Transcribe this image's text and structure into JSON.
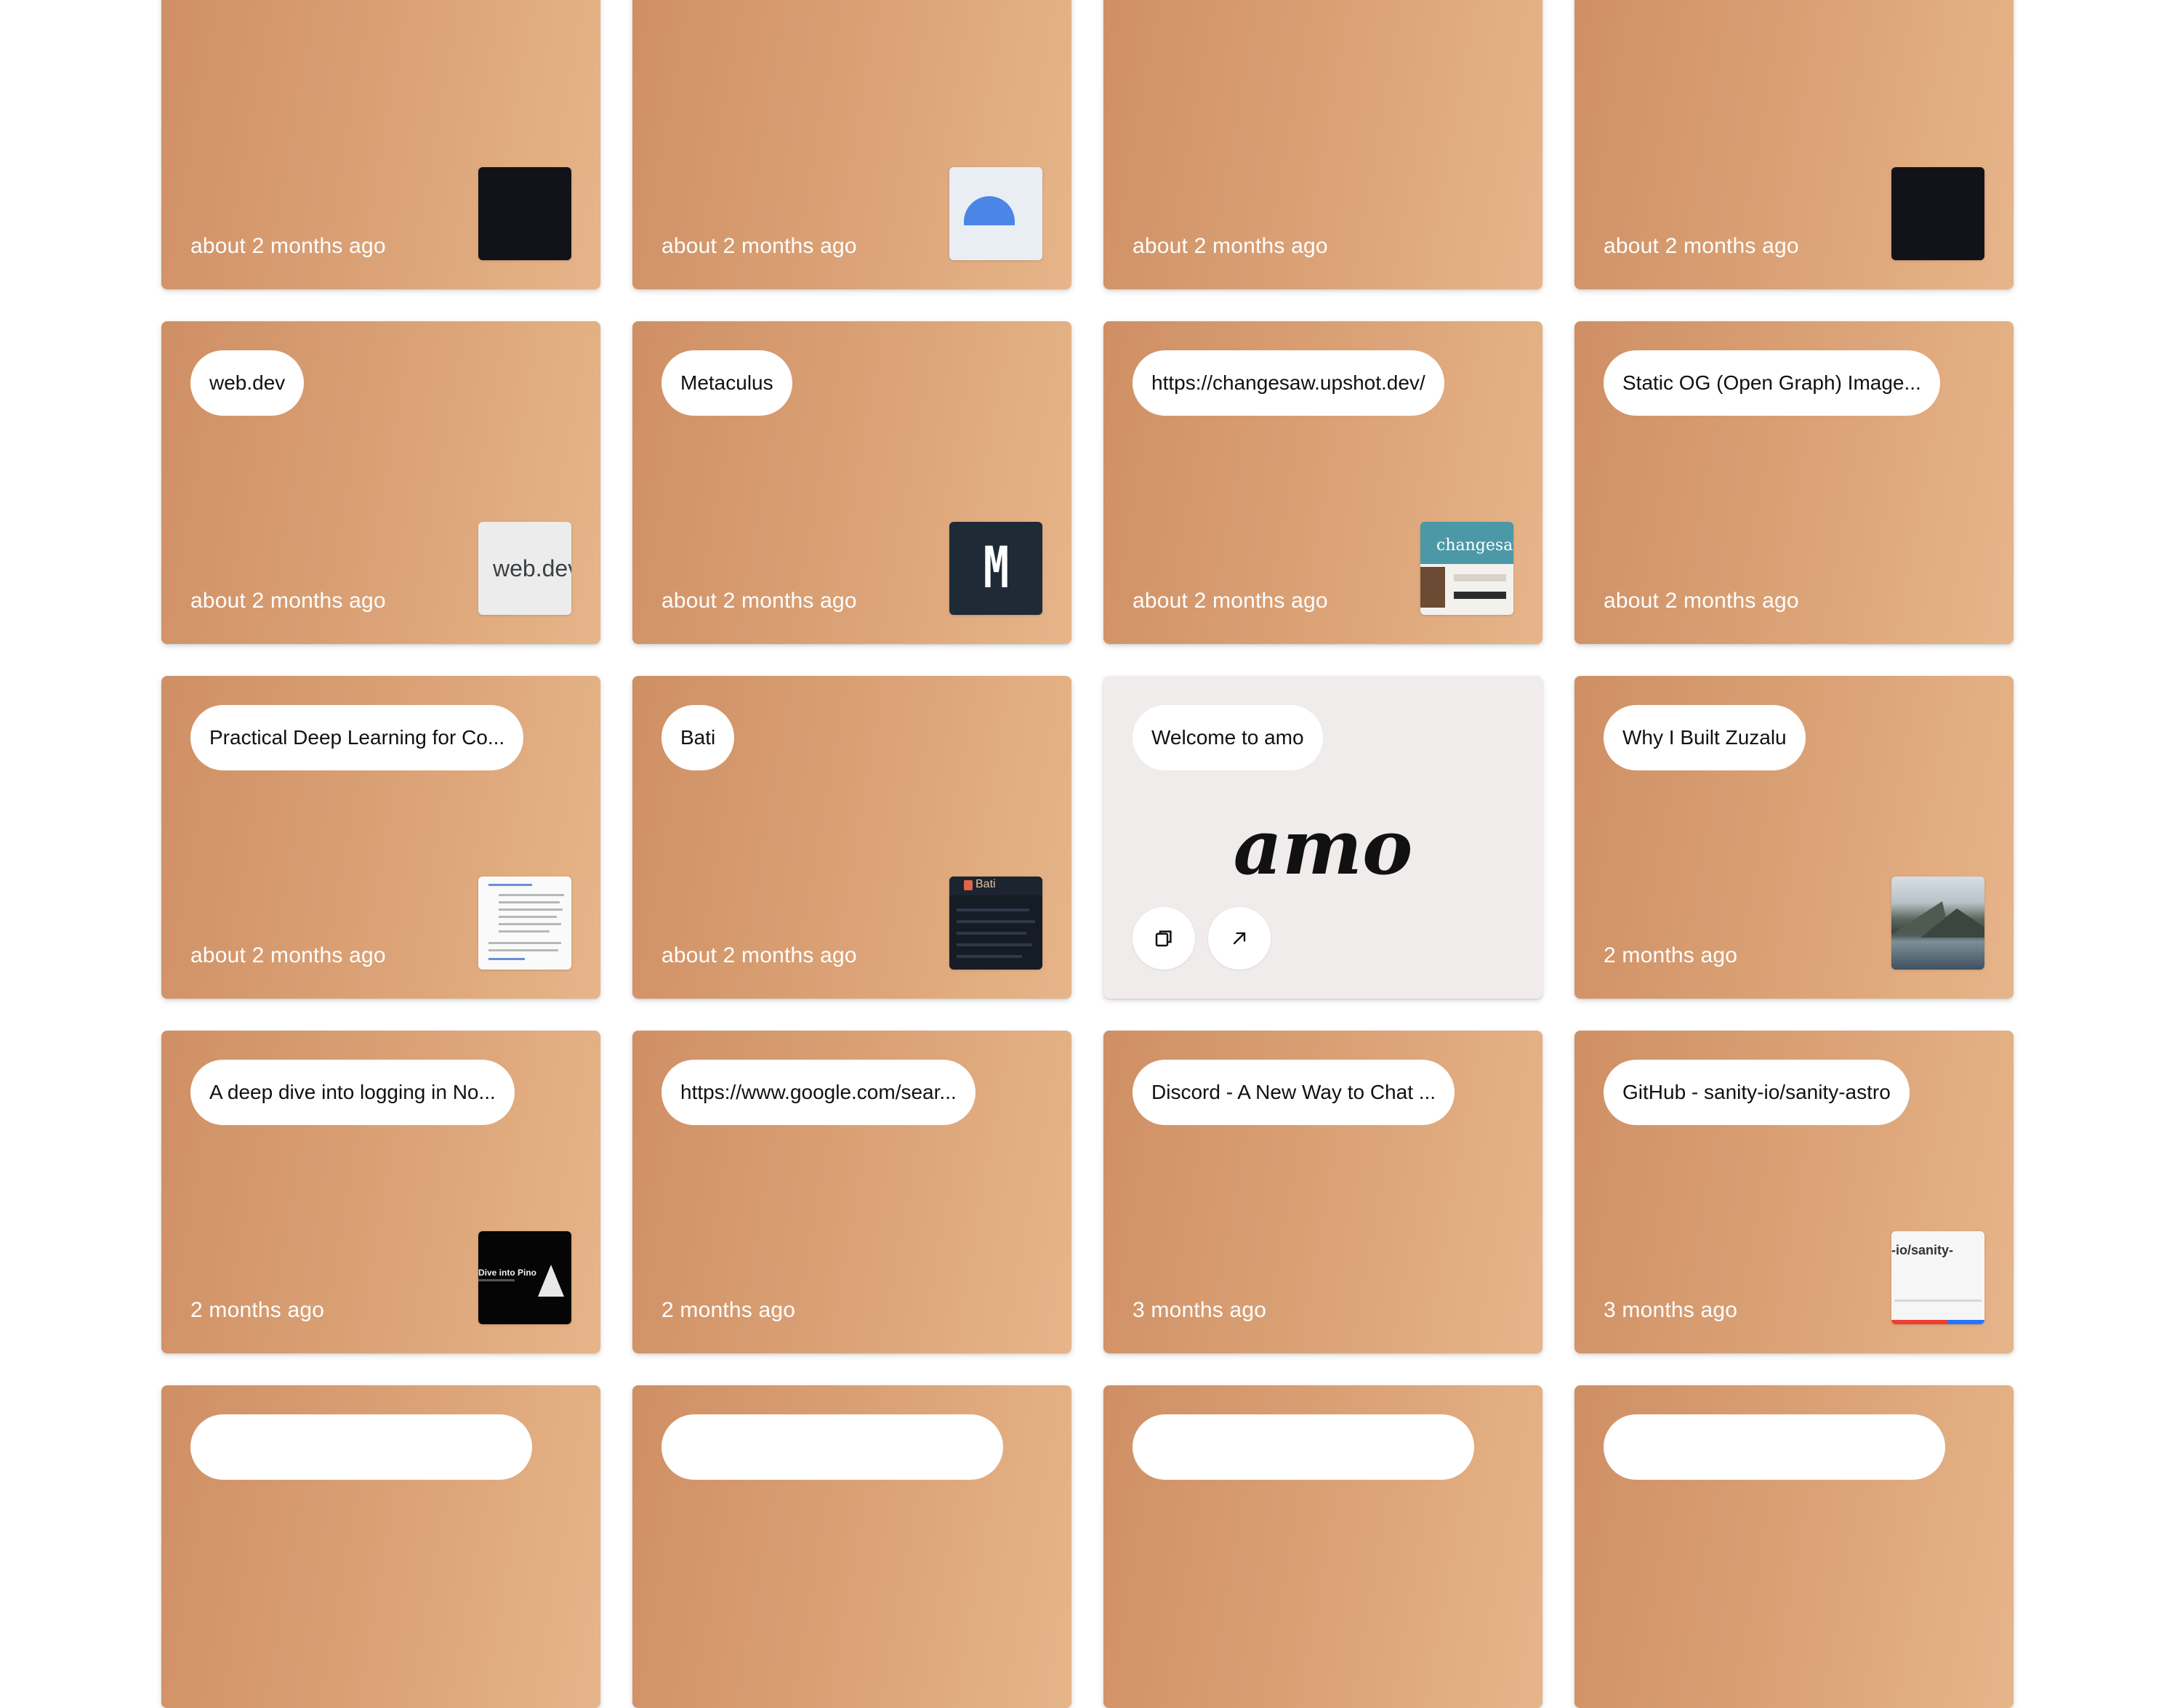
{
  "cards": [
    {
      "title": "",
      "time": "about 2 months ago",
      "thumb": "dark-screenshot"
    },
    {
      "title": "",
      "time": "about 2 months ago",
      "thumb": "blue-illustration"
    },
    {
      "title": "",
      "time": "about 2 months ago",
      "thumb": "none"
    },
    {
      "title": "",
      "time": "about 2 months ago",
      "thumb": "dark-screenshot"
    },
    {
      "title": "web.dev",
      "time": "about 2 months ago",
      "thumb": "web.dev"
    },
    {
      "title": "Metaculus",
      "time": "about 2 months ago",
      "thumb": "M"
    },
    {
      "title": "https://changesaw.upshot.dev/",
      "time": "about 2 months ago",
      "thumb": "changesaw"
    },
    {
      "title": "Static OG (Open Graph) Image...",
      "time": "about 2 months ago",
      "thumb": "none"
    },
    {
      "title": "Practical Deep Learning for Co...",
      "time": "about 2 months ago",
      "thumb": "doc"
    },
    {
      "title": "Bati",
      "time": "about 2 months ago",
      "thumb": "Bati"
    },
    {
      "title": "Welcome to amo",
      "time": "",
      "thumb": "amo-logo"
    },
    {
      "title": "Why I Built Zuzalu",
      "time": "2 months ago",
      "thumb": "lake"
    },
    {
      "title": "A deep dive into logging in No...",
      "time": "2 months ago",
      "thumb": "Dive into Pino"
    },
    {
      "title": "https://www.google.com/sear...",
      "time": "2 months ago",
      "thumb": "none"
    },
    {
      "title": "Discord - A New Way to Chat ...",
      "time": "3 months ago",
      "thumb": "none"
    },
    {
      "title": "GitHub - sanity-io/sanity-astro",
      "time": "3 months ago",
      "thumb": "-io/sanity-"
    },
    {
      "title": "",
      "time": "",
      "thumb": "none"
    },
    {
      "title": "",
      "time": "",
      "thumb": "none"
    },
    {
      "title": "",
      "time": "",
      "thumb": "none"
    },
    {
      "title": "",
      "time": "",
      "thumb": "none"
    }
  ],
  "thumb_text": {
    "webdev": "web.dev",
    "metaculus": "M",
    "changesaw": "changesaw",
    "bati": "Bati",
    "pino": "Dive into Pino",
    "sanity": "-io/sanity-"
  },
  "amo_card": {
    "logo_text": "amo",
    "copy_icon": "copy-icon",
    "open_icon": "arrow-up-right-icon"
  },
  "colors": {
    "card_gradient_start": "#cf8f64",
    "card_gradient_end": "#e6b589",
    "amo_card_bg": "#efeceb"
  }
}
